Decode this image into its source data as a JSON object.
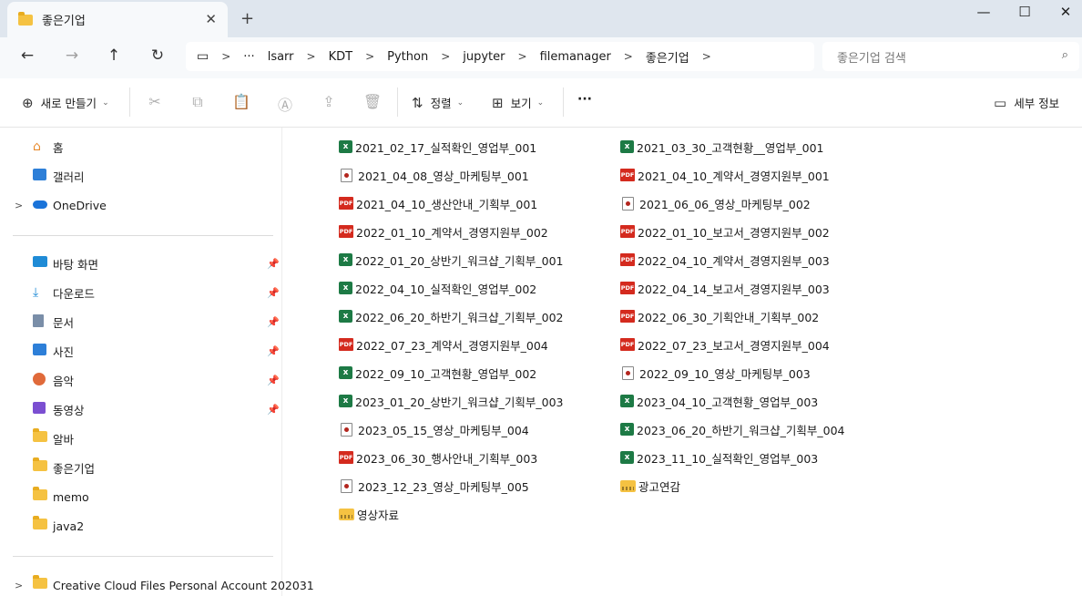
{
  "window": {
    "tab_title": "좋은기업",
    "tab_close_glyph": "✕",
    "new_tab_glyph": "+",
    "minimize_glyph": "—",
    "maximize_glyph": "☐",
    "close_glyph": "✕"
  },
  "nav": {
    "back_glyph": "←",
    "forward_glyph": "→",
    "up_glyph": "↑",
    "refresh_glyph": "↻",
    "breadcrumb": [
      "lsarr",
      "KDT",
      "Python",
      "jupyter",
      "filemanager",
      "좋은기업"
    ],
    "more_glyph": "···",
    "sep_glyph": ">",
    "search_placeholder": "좋은기업 검색",
    "search_glyph": "⌕"
  },
  "toolbar": {
    "new_label": "새로 만들기",
    "sort_label": "정렬",
    "view_label": "보기",
    "more_glyph": "···",
    "details_label": "세부 정보"
  },
  "sidebar": {
    "top": [
      {
        "label": "홈",
        "icon": "home-icon"
      },
      {
        "label": "갤러리",
        "icon": "gallery-icon"
      },
      {
        "label": "OneDrive",
        "icon": "cloud-icon"
      }
    ],
    "quick": [
      {
        "label": "바탕 화면",
        "icon": "desktop-icon",
        "pinned": true
      },
      {
        "label": "다운로드",
        "icon": "download-icon",
        "pinned": true
      },
      {
        "label": "문서",
        "icon": "documents-icon",
        "pinned": true
      },
      {
        "label": "사진",
        "icon": "pictures-icon",
        "pinned": true
      },
      {
        "label": "음악",
        "icon": "music-icon",
        "pinned": true
      },
      {
        "label": "동영상",
        "icon": "videos-icon",
        "pinned": true
      },
      {
        "label": "알바",
        "icon": "folder-icon",
        "pinned": false
      },
      {
        "label": "좋은기업",
        "icon": "folder-icon",
        "pinned": false
      },
      {
        "label": "memo",
        "icon": "folder-icon",
        "pinned": false
      },
      {
        "label": "java2",
        "icon": "folder-icon",
        "pinned": false
      }
    ],
    "bottom": [
      {
        "label": "Creative Cloud Files Personal Account 202031",
        "icon": "folder-icon"
      }
    ]
  },
  "files": [
    {
      "name": "2021_02_17_실적확인_영업부_001",
      "type": "xlsx"
    },
    {
      "name": "2021_03_30_고객현황__영업부_001",
      "type": "xlsx"
    },
    {
      "name": "2021_04_08_영상_마케팅부_001",
      "type": "video"
    },
    {
      "name": "2021_04_10_계약서_경영지원부_001",
      "type": "pdf"
    },
    {
      "name": "2021_04_10_생산안내_기획부_001",
      "type": "pdf"
    },
    {
      "name": "2021_06_06_영상_마케팅부_002",
      "type": "video"
    },
    {
      "name": "2022_01_10_계약서_경영지원부_002",
      "type": "pdf"
    },
    {
      "name": "2022_01_10_보고서_경영지원부_002",
      "type": "pdf"
    },
    {
      "name": "2022_01_20_상반기_워크샵_기획부_001",
      "type": "xlsx"
    },
    {
      "name": "2022_04_10_계약서_경영지원부_003",
      "type": "pdf"
    },
    {
      "name": "2022_04_10_실적확인_영업부_002",
      "type": "xlsx"
    },
    {
      "name": "2022_04_14_보고서_경영지원부_003",
      "type": "pdf"
    },
    {
      "name": "2022_06_20_하반기_워크샵_기획부_002",
      "type": "xlsx"
    },
    {
      "name": "2022_06_30_기획안내_기획부_002",
      "type": "pdf"
    },
    {
      "name": "2022_07_23_계약서_경영지원부_004",
      "type": "pdf"
    },
    {
      "name": "2022_07_23_보고서_경영지원부_004",
      "type": "pdf"
    },
    {
      "name": "2022_09_10_고객현황_영업부_002",
      "type": "xlsx"
    },
    {
      "name": "2022_09_10_영상_마케팅부_003",
      "type": "video"
    },
    {
      "name": "2023_01_20_상반기_워크샵_기획부_003",
      "type": "xlsx"
    },
    {
      "name": "2023_04_10_고객현황_영업부_003",
      "type": "xlsx"
    },
    {
      "name": "2023_05_15_영상_마케팅부_004",
      "type": "video"
    },
    {
      "name": "2023_06_20_하반기_워크샵_기획부_004",
      "type": "xlsx"
    },
    {
      "name": "2023_06_30_행사안내_기획부_003",
      "type": "pdf"
    },
    {
      "name": "2023_11_10_실적확인_영업부_003",
      "type": "xlsx"
    },
    {
      "name": "2023_12_23_영상_마케팅부_005",
      "type": "video"
    },
    {
      "name": "광고연감",
      "type": "zip"
    },
    {
      "name": "영상자료",
      "type": "zip"
    }
  ]
}
